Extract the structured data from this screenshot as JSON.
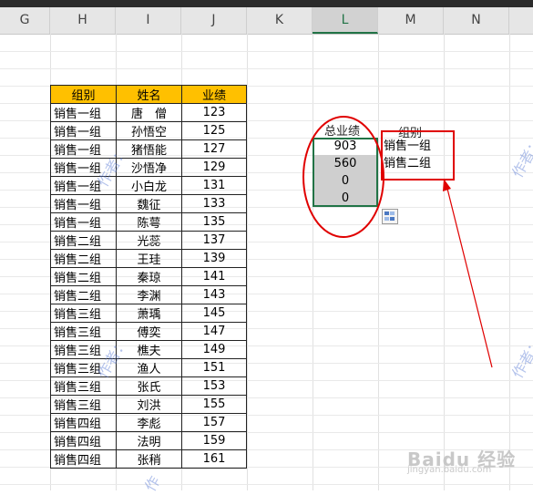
{
  "columns": [
    "G",
    "H",
    "I",
    "J",
    "K",
    "L",
    "M",
    "N"
  ],
  "selected_column": "L",
  "table": {
    "headers": [
      "组别",
      "姓名",
      "业绩"
    ],
    "rows": [
      [
        "销售一组",
        "唐　僧",
        "123"
      ],
      [
        "销售一组",
        "孙悟空",
        "125"
      ],
      [
        "销售一组",
        "猪悟能",
        "127"
      ],
      [
        "销售一组",
        "沙悟净",
        "129"
      ],
      [
        "销售一组",
        "小白龙",
        "131"
      ],
      [
        "销售一组",
        "魏征",
        "133"
      ],
      [
        "销售一组",
        "陈萼",
        "135"
      ],
      [
        "销售二组",
        "光蕊",
        "137"
      ],
      [
        "销售二组",
        "王珪",
        "139"
      ],
      [
        "销售二组",
        "秦琼",
        "141"
      ],
      [
        "销售二组",
        "李渊",
        "143"
      ],
      [
        "销售三组",
        "萧瑀",
        "145"
      ],
      [
        "销售三组",
        "傅奕",
        "147"
      ],
      [
        "销售三组",
        "樵夫",
        "149"
      ],
      [
        "销售三组",
        "渔人",
        "151"
      ],
      [
        "销售三组",
        "张氏",
        "153"
      ],
      [
        "销售三组",
        "刘洪",
        "155"
      ],
      [
        "销售四组",
        "李彪",
        "157"
      ],
      [
        "销售四组",
        "法明",
        "159"
      ],
      [
        "销售四组",
        "张稍",
        "161"
      ]
    ]
  },
  "summary": {
    "total_header": "总业绩",
    "group_header": "组别",
    "totals": [
      "903",
      "560",
      "0",
      "0"
    ],
    "groups": [
      "销售一组",
      "销售二组"
    ]
  },
  "watermarks": [
    "作者：",
    "作者：",
    "作者：",
    "作者：",
    "作"
  ],
  "branding": {
    "logo": "Baidu 经验",
    "sub": "jingyan.baidu.com"
  },
  "colors": {
    "header_fill": "#ffc000",
    "selection_green": "#217346",
    "annotation_red": "#e00000",
    "watermark": "#5b7bd5"
  }
}
